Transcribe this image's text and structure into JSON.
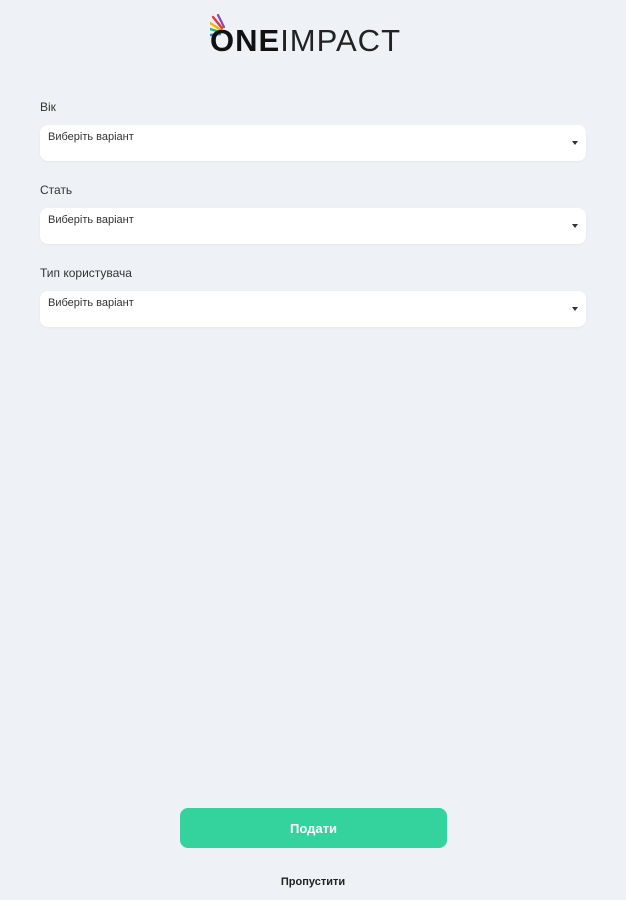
{
  "brand": {
    "logo_one": "ONE",
    "logo_impact": "IMPACT",
    "colors": {
      "ray_red": "#e8343f",
      "ray_yellow": "#f4b400",
      "ray_green": "#2bb673",
      "ray_blue": "#2f80ed",
      "ray_purple": "#8e44ad"
    }
  },
  "form": {
    "fields": [
      {
        "label": "Вік",
        "value": "Виберіть варіант"
      },
      {
        "label": "Стать",
        "value": "Виберіть варіант"
      },
      {
        "label": "Тип користувача",
        "value": "Виберіть варіант"
      }
    ],
    "submit_label": "Подати",
    "skip_label": "Пропустити"
  },
  "colors": {
    "background": "#eef2f6",
    "accent": "#34d39e"
  }
}
